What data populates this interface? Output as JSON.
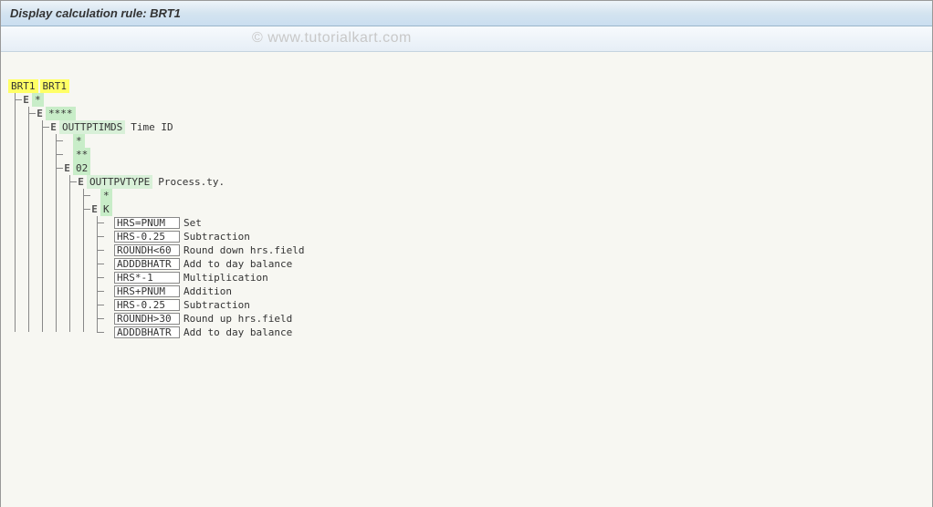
{
  "titlebar": {
    "text": "Display calculation rule: BRT1"
  },
  "watermark": "© www.tutorialkart.com",
  "tree": {
    "root_code1": "BRT1",
    "root_code2": "BRT1",
    "l1": {
      "marker": "E",
      "label": "*"
    },
    "l2": {
      "marker": "E",
      "label": "****"
    },
    "l3": {
      "marker": "E",
      "code": "OUTTPTIMDS",
      "desc": "Time ID"
    },
    "l4_items": [
      {
        "label": "*"
      },
      {
        "label": "**"
      },
      {
        "label": "02"
      }
    ],
    "l5": {
      "marker": "E",
      "code": "OUTTPVTYPE",
      "desc": "Process.ty."
    },
    "l6_items": [
      {
        "label": "*"
      },
      {
        "label": "K"
      }
    ],
    "l7_leaves": [
      {
        "code": "HRS=PNUM",
        "desc": "Set"
      },
      {
        "code": "HRS-0.25",
        "desc": "Subtraction"
      },
      {
        "code": "ROUNDH<60",
        "desc": "Round down hrs.field"
      },
      {
        "code": "ADDDBHATR",
        "desc": "Add to day balance"
      },
      {
        "code": "HRS*-1",
        "desc": "Multiplication"
      },
      {
        "code": "HRS+PNUM",
        "desc": "Addition"
      },
      {
        "code": "HRS-0.25",
        "desc": "Subtraction"
      },
      {
        "code": "ROUNDH>30",
        "desc": "Round up hrs.field"
      },
      {
        "code": "ADDDBHATR",
        "desc": "Add to day balance"
      }
    ]
  }
}
